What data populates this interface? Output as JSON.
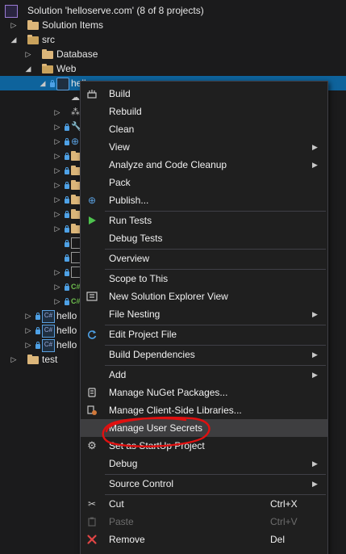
{
  "tree": {
    "solution_label": "Solution 'helloserve.com' (8 of 8 projects)",
    "items": [
      {
        "label": "Solution Items"
      },
      {
        "label": "src"
      },
      {
        "label": "Database"
      },
      {
        "label": "Web"
      },
      {
        "label": "hello"
      },
      {
        "label": "hello"
      },
      {
        "label": "hello"
      },
      {
        "label": "hello"
      },
      {
        "label": "test"
      }
    ]
  },
  "menu": {
    "items": [
      {
        "label": "Build",
        "icon": "build-icon"
      },
      {
        "label": "Rebuild"
      },
      {
        "label": "Clean"
      },
      {
        "label": "View",
        "submenu": "›"
      },
      {
        "label": "Analyze and Code Cleanup",
        "submenu": "›"
      },
      {
        "label": "Pack"
      },
      {
        "label": "Publish...",
        "icon": "globe-icon"
      },
      {
        "label": "Run Tests",
        "icon": "play-icon"
      },
      {
        "label": "Debug Tests"
      },
      {
        "label": "Overview"
      },
      {
        "label": "Scope to This"
      },
      {
        "label": "New Solution Explorer View",
        "icon": "new-view-icon"
      },
      {
        "label": "File Nesting",
        "submenu": "›"
      },
      {
        "label": "Edit Project File",
        "icon": "refresh-icon"
      },
      {
        "label": "Build Dependencies",
        "submenu": "›"
      },
      {
        "label": "Add",
        "submenu": "›"
      },
      {
        "label": "Manage NuGet Packages...",
        "icon": "nuget-icon"
      },
      {
        "label": "Manage Client-Side Libraries...",
        "icon": "client-libs-icon"
      },
      {
        "label": "Manage User Secrets"
      },
      {
        "label": "Set as StartUp Project",
        "icon": "gear-icon"
      },
      {
        "label": "Debug",
        "submenu": "›"
      },
      {
        "label": "Source Control",
        "submenu": "›"
      },
      {
        "label": "Cut",
        "shortcut": "Ctrl+X",
        "icon": "scissors-icon"
      },
      {
        "label": "Paste",
        "shortcut": "Ctrl+V"
      },
      {
        "label": "Remove",
        "shortcut": "Del",
        "icon": "remove-icon"
      }
    ]
  },
  "colors": {
    "background": "#1b1b1c",
    "selection": "#0e639c",
    "menu_bg": "#1f1f1f",
    "menu_hover": "#3e3e40",
    "annotation": "#e01010",
    "play_green": "#4ec24e",
    "remove_red": "#e04545"
  }
}
